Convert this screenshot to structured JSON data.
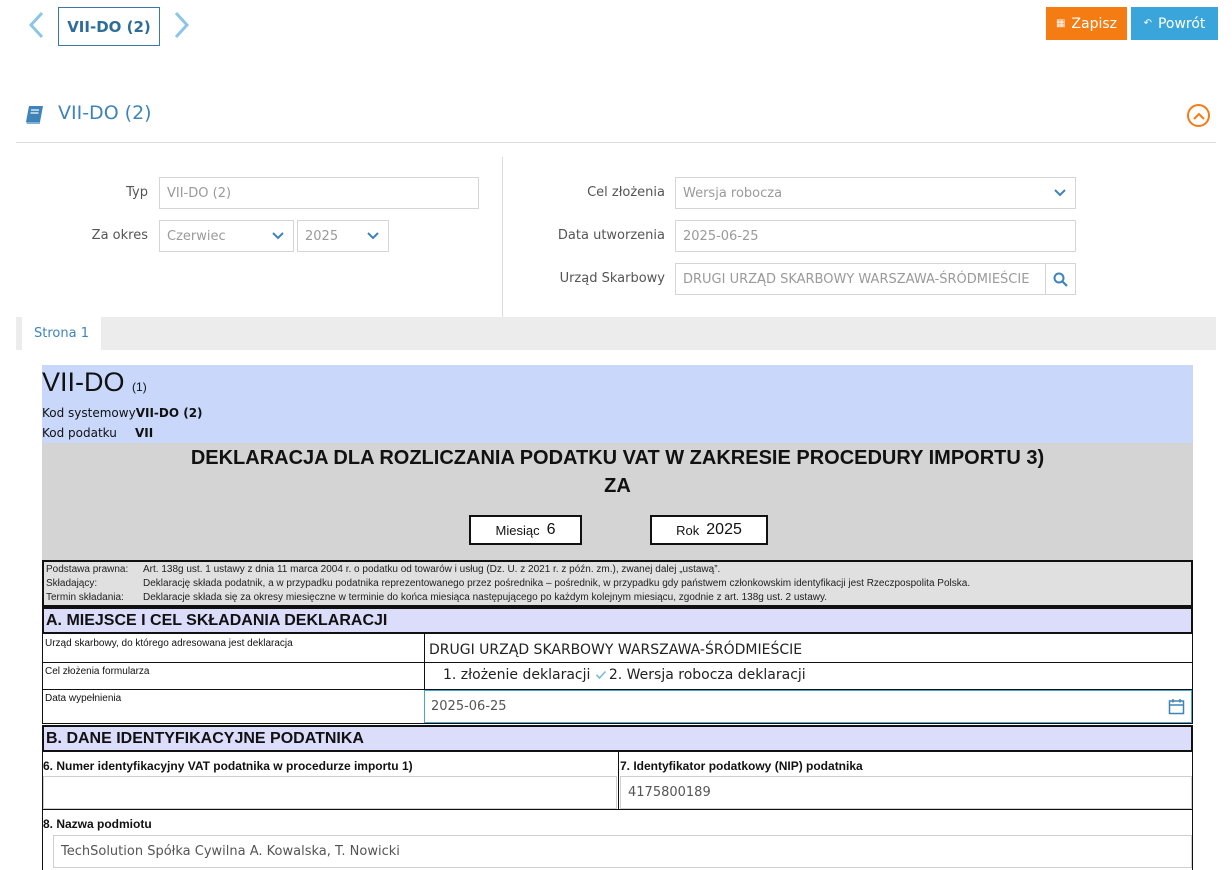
{
  "nav": {
    "current_tab": "VII-DO (2)",
    "save_label": "Zapisz",
    "back_label": "Powrót"
  },
  "section": {
    "title": "VII-DO (2)"
  },
  "filters": {
    "typ_label": "Typ",
    "typ_value": "VII-DO (2)",
    "okres_label": "Za okres",
    "month_value": "Czerwiec",
    "year_value": "2025",
    "cel_label": "Cel złożenia",
    "cel_value": "Wersja robocza",
    "data_label": "Data utworzenia",
    "data_value": "2025-06-25",
    "urzad_label": "Urząd Skarbowy",
    "urzad_value": "DRUGI URZĄD SKARBOWY WARSZAWA-ŚRÓDMIEŚCIE"
  },
  "tabs": [
    {
      "label": "Strona 1"
    }
  ],
  "form": {
    "code": "VII-DO",
    "variant": "(1)",
    "kod_systemowy_label": "Kod systemowy",
    "kod_systemowy_value": "VII-DO (2)",
    "kod_podatku_label": "Kod podatku",
    "kod_podatku_value": "VII",
    "title_line1": "DEKLARACJA DLA ROZLICZANIA PODATKU VAT W ZAKRESIE PROCEDURY IMPORTU 3)",
    "title_line2": "ZA",
    "month_label": "Miesiąc",
    "month_value": "6",
    "year_label": "Rok",
    "year_value": "2025",
    "legal": [
      {
        "k": "Podstawa prawna:",
        "v": "Art. 138g ust. 1 ustawy z dnia 11 marca 2004 r. o podatku od towarów i usług (Dz. U. z 2021 r. z późn. zm.), zwanej dalej „ustawą”."
      },
      {
        "k": "Składający:",
        "v": "Deklarację składa podatnik, a w przypadku podatnika reprezentowanego przez pośrednika – pośrednik, w przypadku gdy państwem członkowskim identyfikacji jest Rzeczpospolita Polska."
      },
      {
        "k": "Termin składania:",
        "v": "Deklaracje składa się za okresy miesięczne w terminie do końca miesiąca następującego po każdym kolejnym miesiącu, zgodnie z art. 138g ust. 2 ustawy."
      }
    ],
    "section_a": "A. MIEJSCE I CEL SKŁADANIA DEKLARACJI",
    "urzad_row_label": "Urząd skarbowy, do którego adresowana jest deklaracja",
    "urzad_row_value": "DRUGI URZĄD SKARBOWY WARSZAWA-ŚRÓDMIEŚCIE",
    "cel_row_label": "Cel złożenia formularza",
    "cel_opt1": "1. złożenie deklaracji",
    "cel_opt2": "2. Wersja robocza deklaracji",
    "data_row_label": "Data wypełnienia",
    "data_row_value": "2025-06-25",
    "section_b": "B. DANE IDENTYFIKACYJNE PODATNIKA",
    "field6_label": "6. Numer identyfikacyjny VAT podatnika w procedurze importu 1)",
    "field6_value": "",
    "field7_label": "7. Identyfikator podatkowy (NIP) podatnika",
    "field7_value": "4175800189",
    "field8_label": "8. Nazwa podmiotu",
    "field8_value": "TechSolution Spółka Cywilna A. Kowalska, T. Nowicki"
  }
}
